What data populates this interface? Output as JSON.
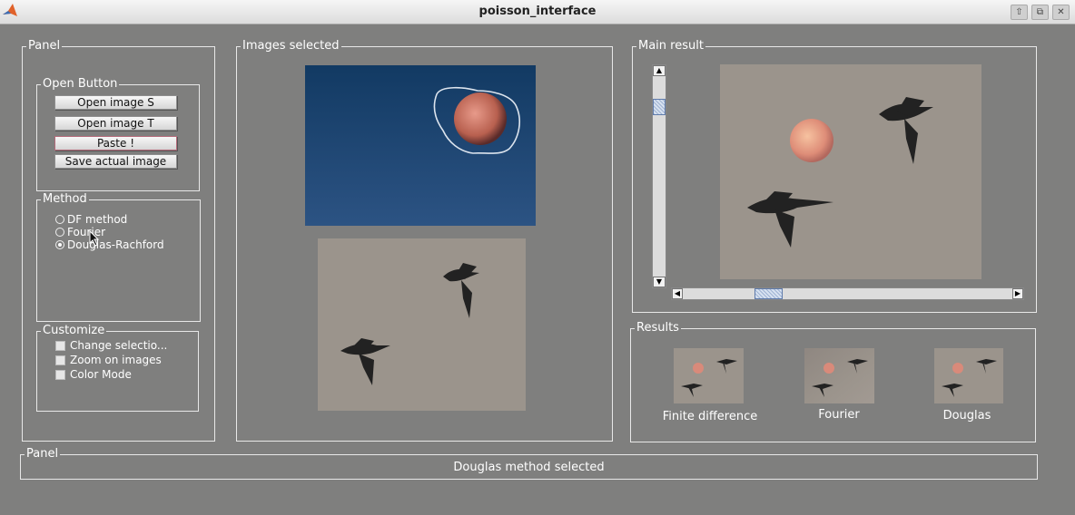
{
  "window": {
    "title": "poisson_interface"
  },
  "left_panel": {
    "title": "Panel",
    "open_group": {
      "title": "Open Button",
      "buttons": [
        "Open image S",
        "Open image T",
        "Paste !",
        "Save actual image"
      ]
    },
    "method_group": {
      "title": "Method",
      "options": [
        "DF method",
        "Fourier",
        "Douglas-Rachford"
      ],
      "selected": "Douglas-Rachford"
    },
    "customize_group": {
      "title": "Customize",
      "options": [
        "Change selectio...",
        "Zoom on images",
        "Color Mode"
      ]
    }
  },
  "images_panel": {
    "title": "Images selected"
  },
  "main_panel": {
    "title": "Main result"
  },
  "results_panel": {
    "title": "Results",
    "items": [
      "Finite difference",
      "Fourier",
      "Douglas"
    ]
  },
  "status_panel": {
    "title": "Panel",
    "message": "Douglas method selected"
  },
  "colors": {
    "background": "#7f7f7e",
    "sky": "#1f4673",
    "beige": "#9b948c",
    "moon": "#d98a7a"
  }
}
